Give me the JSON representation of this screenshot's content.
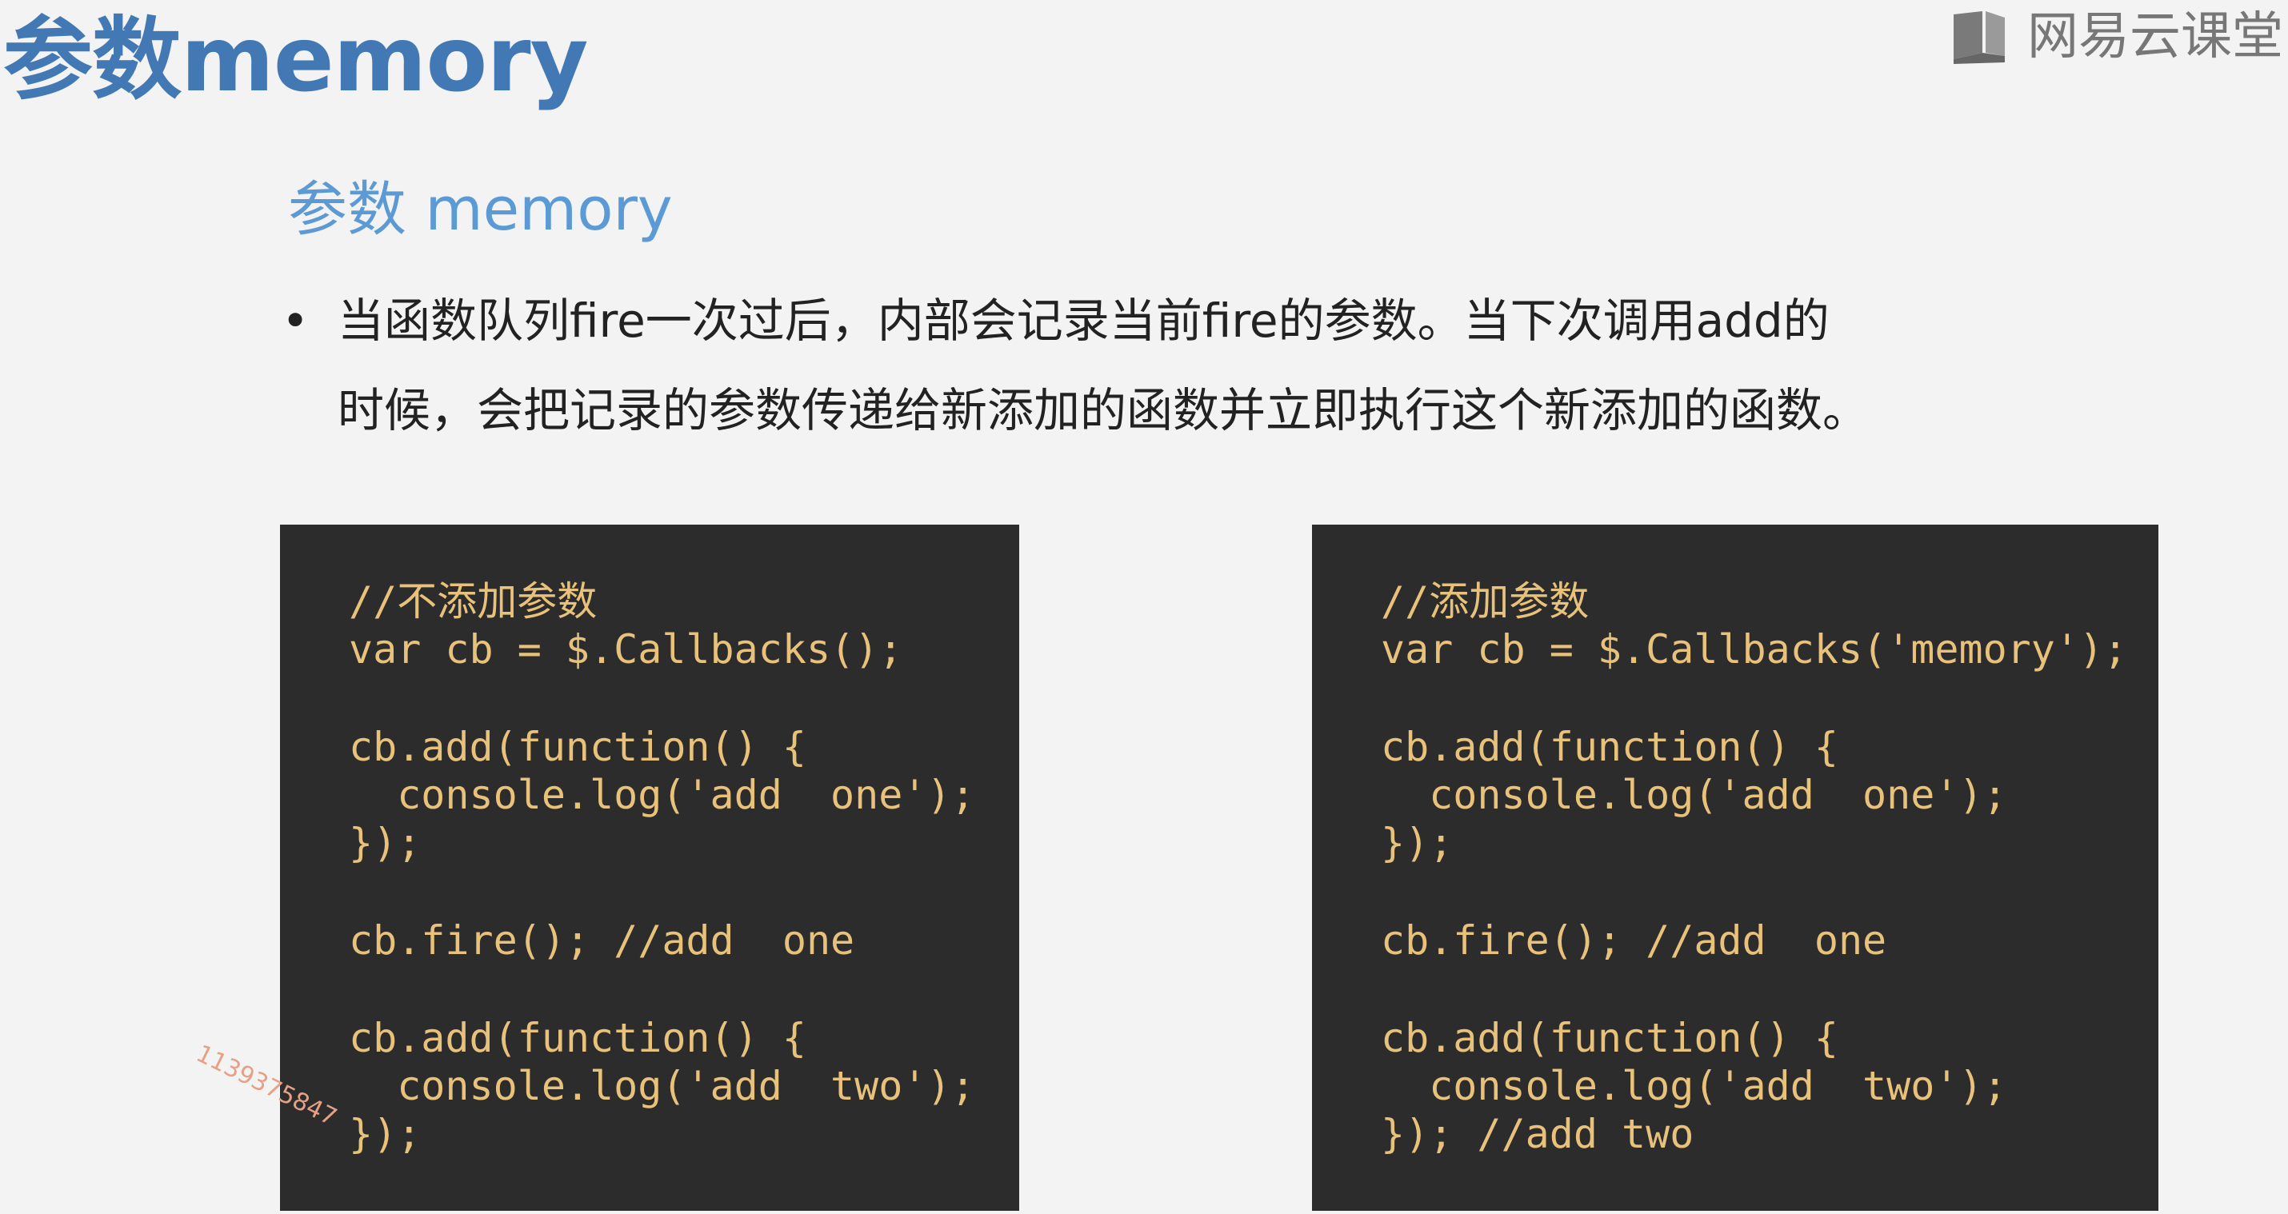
{
  "header": {
    "title": "参数memory",
    "logo_text": "网易云课堂",
    "logo_icon": "book-icon"
  },
  "content": {
    "section_title": "参数 memory",
    "bullet_marker": "•",
    "bullet_line1": "当函数队列fire一次过后，内部会记录当前fire的参数。当下次调用add的",
    "bullet_line2": "时候，会把记录的参数传递给新添加的函数并立即执行这个新添加的函数。"
  },
  "code_left": {
    "l1": "//不添加参数",
    "l2": "var cb = $.Callbacks();",
    "l3": "cb.add(function() {",
    "l4": "  console.log('add  one');",
    "l5": "});",
    "l6": "cb.fire(); //add  one",
    "l7": "cb.add(function() {",
    "l8": "  console.log('add  two');",
    "l9": "});"
  },
  "code_right": {
    "l1": "//添加参数",
    "l2": "var cb = $.Callbacks('memory');",
    "l3": "cb.add(function() {",
    "l4": "  console.log('add  one');",
    "l5": "});",
    "l6": "cb.fire(); //add  one",
    "l7": "cb.add(function() {",
    "l8": "  console.log('add  two');",
    "l9": "}); //add two"
  },
  "watermark": "1139375847",
  "colors": {
    "background": "#f3f3f3",
    "title": "#4279b4",
    "section_title": "#5b9ad4",
    "code_bg": "#2c2c2c",
    "code_text": "#e8c17b",
    "watermark": "#e6a184"
  }
}
